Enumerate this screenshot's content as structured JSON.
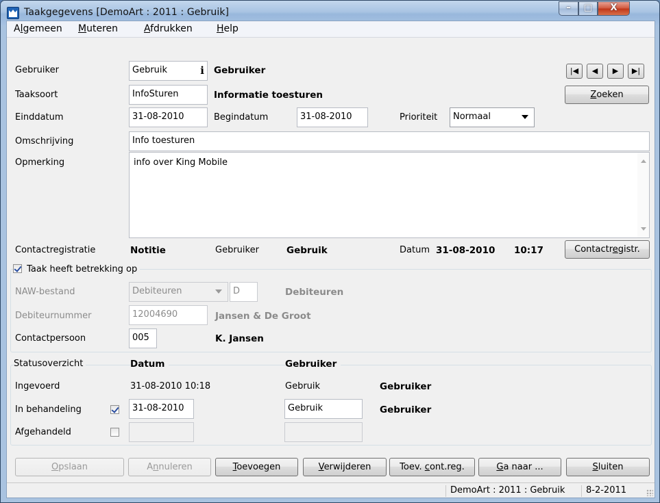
{
  "window": {
    "title": "Taakgegevens  [DemoArt : 2011 : Gebruik]",
    "controls": {
      "minimize": "–",
      "maximize": "□",
      "close": "X"
    }
  },
  "menu": {
    "items": [
      {
        "pre": "A",
        "ul": "l",
        "post": "gemeen"
      },
      {
        "pre": "",
        "ul": "M",
        "post": "uteren"
      },
      {
        "pre": "",
        "ul": "A",
        "post": "fdrukken"
      },
      {
        "pre": "",
        "ul": "H",
        "post": "elp"
      }
    ]
  },
  "task": {
    "gebruiker_label": "Gebruiker",
    "gebruiker_value": "Gebruik",
    "gebruiker_name": "Gebruiker",
    "info_glyph": "i",
    "taaksoort_label": "Taaksoort",
    "taaksoort_value": "InfoSturen",
    "taaksoort_name": "Informatie toesturen",
    "einddatum_label": "Einddatum",
    "einddatum_value": "31-08-2010",
    "begindatum_label": "Begindatum",
    "begindatum_value": "31-08-2010",
    "prioriteit_label": "Prioriteit",
    "prioriteit_value": "Normaal",
    "omschrijving_label": "Omschrijving",
    "omschrijving_value": "Info toesturen",
    "opmerking_label": "Opmerking",
    "opmerking_value": "info over King Mobile"
  },
  "nav": {
    "first": "|◀",
    "prev": "◀",
    "next": "▶",
    "last": "▶|"
  },
  "zoeken": {
    "ul": "Z",
    "post": "oeken"
  },
  "contact": {
    "label": "Contactregistratie",
    "type": "Notitie",
    "gebruiker_label": "Gebruiker",
    "gebruiker_value": "Gebruik",
    "datum_label": "Datum",
    "datum_value": "31-08-2010",
    "tijd_value": "10:17",
    "button_pre": "Contactr",
    "button_ul": "e",
    "button_post": "gistr."
  },
  "betrekking": {
    "checkbox_label": "Taak heeft betrekking op",
    "checked": true,
    "naw_label": "NAW-bestand",
    "naw_value": "Debiteuren",
    "naw_code": "D",
    "naw_name": "Debiteuren",
    "debnr_label": "Debiteurnummer",
    "debnr_value": "12004690",
    "debnr_name": "Jansen & De Groot",
    "contact_label": "Contactpersoon",
    "contact_value": "005",
    "contact_name": "K. Jansen"
  },
  "status": {
    "header_label": "Statusoverzicht",
    "header_datum": "Datum",
    "header_gebruiker": "Gebruiker",
    "ingevoerd_label": "Ingevoerd",
    "ingevoerd_datum": "31-08-2010 10:18",
    "ingevoerd_gebruiker": "Gebruik",
    "ingevoerd_naam": "Gebruiker",
    "behandeling_label": "In behandeling",
    "behandeling_checked": true,
    "behandeling_datum": "31-08-2010",
    "behandeling_gebruiker": "Gebruik",
    "behandeling_naam": "Gebruiker",
    "afgehandeld_label": "Afgehandeld",
    "afgehandeld_checked": false
  },
  "buttons": {
    "opslaan": {
      "pre": "",
      "ul": "O",
      "post": "pslaan"
    },
    "annuleren": {
      "pre": "A",
      "ul": "n",
      "post": "nuleren"
    },
    "toevoegen": {
      "pre": "",
      "ul": "T",
      "post": "oevoegen"
    },
    "verwijderen": {
      "pre": "",
      "ul": "V",
      "post": "erwijderen"
    },
    "toev_cont": {
      "pre": "Toev. ",
      "ul": "c",
      "post": "ont.reg."
    },
    "ganaar": {
      "pre": "",
      "ul": "G",
      "post": "a naar ..."
    },
    "sluiten": {
      "pre": "",
      "ul": "S",
      "post": "luiten"
    }
  },
  "statusbar": {
    "context": "DemoArt : 2011 : Gebruik",
    "date": "8-2-2011"
  }
}
